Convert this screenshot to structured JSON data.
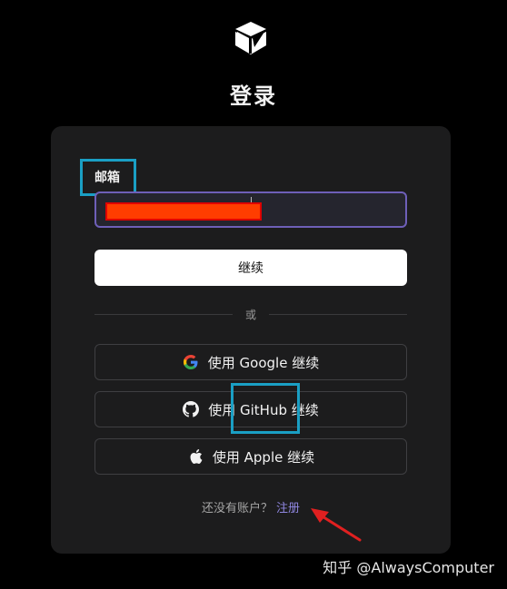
{
  "header": {
    "logo_icon": "cube-icon",
    "title": "登录"
  },
  "form": {
    "email_label": "邮箱",
    "email_value": "",
    "continue_label": "继续",
    "divider_text": "或"
  },
  "oauth": [
    {
      "id": "google",
      "icon": "google-icon",
      "label": "使用 Google 继续"
    },
    {
      "id": "github",
      "icon": "github-icon",
      "label": "使用 GitHub 继续"
    },
    {
      "id": "apple",
      "icon": "apple-icon",
      "label": "使用 Apple 继续"
    }
  ],
  "footer": {
    "prompt": "还没有账户？",
    "signup_label": "注册"
  },
  "annotations": {
    "highlight_color": "#1a9fc4",
    "arrow_color": "#e02020",
    "redaction_color": "#ff3d00"
  },
  "watermark": "知乎 @AlwaysComputer",
  "colors": {
    "background": "#000000",
    "card": "#1c1c1d",
    "input_border": "#6e5fb8",
    "link": "#8f86e0"
  }
}
